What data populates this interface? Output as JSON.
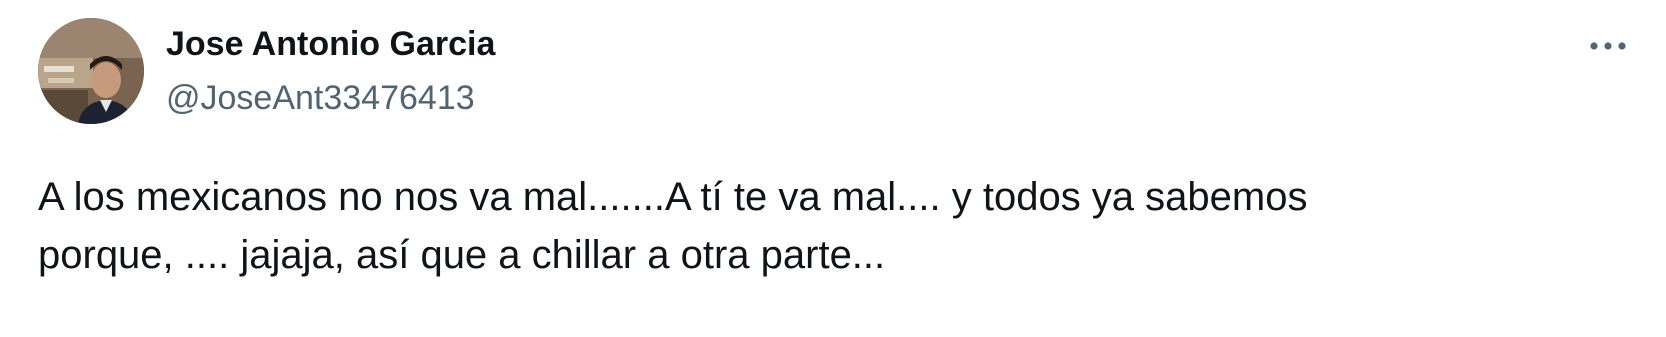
{
  "tweet": {
    "author": {
      "display_name": "Jose Antonio Garcia",
      "handle": "@JoseAnt33476413"
    },
    "text": "A los mexicanos no nos va mal.......A tí te va mal.... y todos ya sabemos\nporque, .... jajaja, así que a chillar a otra parte...",
    "more_icon": "more-horizontal-icon"
  },
  "colors": {
    "text_primary": "#0f1419",
    "text_secondary": "#536471",
    "background": "#ffffff"
  }
}
